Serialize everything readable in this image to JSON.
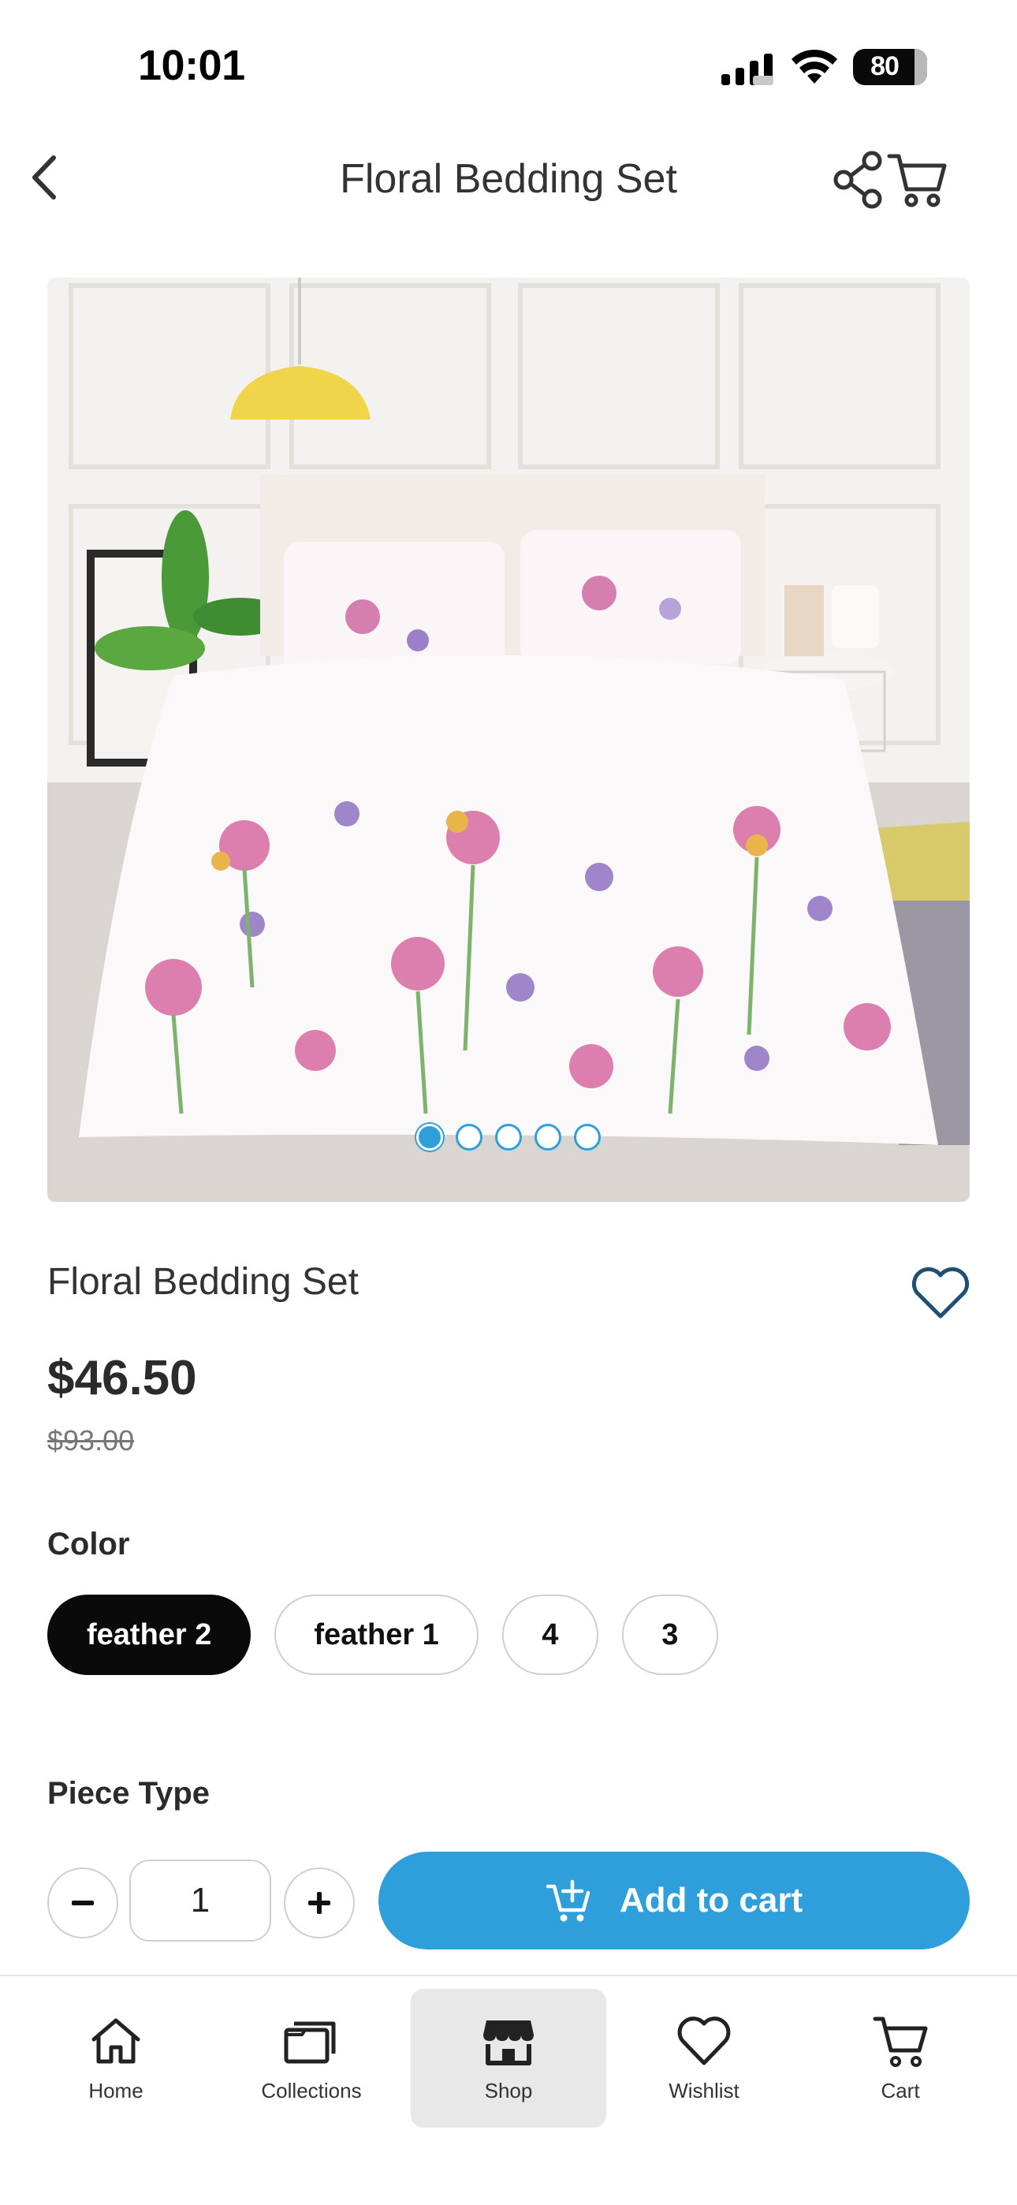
{
  "status_bar": {
    "time": "10:01",
    "battery": "80"
  },
  "header": {
    "title": "Floral Bedding Set"
  },
  "product": {
    "name": "Floral Bedding Set",
    "price": "$46.50",
    "original_price": "$93.00",
    "image_count": 5,
    "active_image_index": 0
  },
  "color": {
    "label": "Color",
    "options": [
      "feather 2",
      "feather 1",
      "4",
      "3"
    ],
    "selected": "feather 2"
  },
  "piece_type": {
    "label": "Piece Type"
  },
  "quantity": {
    "value": "1"
  },
  "actions": {
    "add_to_cart": "Add to cart"
  },
  "tabbar": {
    "items": [
      {
        "label": "Home",
        "icon": "home-icon"
      },
      {
        "label": "Collections",
        "icon": "collections-icon"
      },
      {
        "label": "Shop",
        "icon": "shop-icon"
      },
      {
        "label": "Wishlist",
        "icon": "heart-icon"
      },
      {
        "label": "Cart",
        "icon": "cart-icon"
      }
    ],
    "active": "Shop"
  },
  "colors": {
    "accent": "#2f9fdc",
    "selected_chip": "#0a0a0a",
    "tab_active_bg": "#e8e8e8"
  }
}
